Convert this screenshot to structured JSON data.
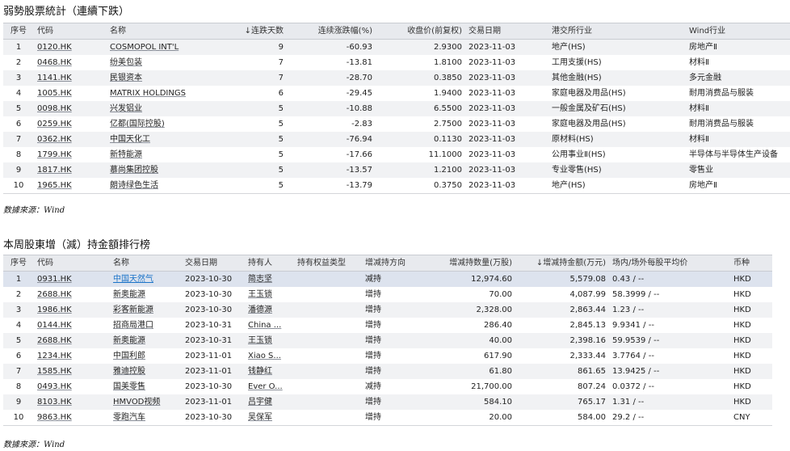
{
  "table1": {
    "title": "弱勢股票統計（連續下跌）",
    "headers": [
      "序号",
      "代码",
      "名称",
      "↓连跌天数",
      "连续涨跌幅(%)",
      "收盘价(前复权)",
      "交易日期",
      "港交所行业",
      "Wind行业"
    ],
    "rows": [
      [
        "1",
        "0120.HK",
        "COSMOPOL INT'L",
        "9",
        "-60.93",
        "2.9300",
        "2023-11-03",
        "地产(HS)",
        "房地产Ⅱ"
      ],
      [
        "2",
        "0468.HK",
        "纷美包装",
        "7",
        "-13.81",
        "1.8100",
        "2023-11-03",
        "工用支援(HS)",
        "材料Ⅱ"
      ],
      [
        "3",
        "1141.HK",
        "民银资本",
        "7",
        "-28.70",
        "0.3850",
        "2023-11-03",
        "其他金融(HS)",
        "多元金融"
      ],
      [
        "4",
        "1005.HK",
        "MATRIX HOLDINGS",
        "6",
        "-29.45",
        "1.9400",
        "2023-11-03",
        "家庭电器及用品(HS)",
        "耐用消费品与服装"
      ],
      [
        "5",
        "0098.HK",
        "兴发铝业",
        "5",
        "-10.88",
        "6.5500",
        "2023-11-03",
        "一般金属及矿石(HS)",
        "材料Ⅱ"
      ],
      [
        "6",
        "0259.HK",
        "亿都(国际控股)",
        "5",
        "-2.83",
        "2.7500",
        "2023-11-03",
        "家庭电器及用品(HS)",
        "耐用消费品与服装"
      ],
      [
        "7",
        "0362.HK",
        "中国天化工",
        "5",
        "-76.94",
        "0.1130",
        "2023-11-03",
        "原材料(HS)",
        "材料Ⅱ"
      ],
      [
        "8",
        "1799.HK",
        "新特能源",
        "5",
        "-17.66",
        "11.1000",
        "2023-11-03",
        "公用事业Ⅱ(HS)",
        "半导体与半导体生产设备"
      ],
      [
        "9",
        "1817.HK",
        "慕尚集团控股",
        "5",
        "-13.57",
        "1.2100",
        "2023-11-03",
        "专业零售(HS)",
        "零售业"
      ],
      [
        "10",
        "1965.HK",
        "朗诗绿色生活",
        "5",
        "-13.79",
        "0.3750",
        "2023-11-03",
        "地产(HS)",
        "房地产Ⅱ"
      ]
    ],
    "source": "数據來源：Wind"
  },
  "table2": {
    "title": "本周股東增（減）持金額排行榜",
    "headers": [
      "序号",
      "代码",
      "名称",
      "交易日期",
      "持有人",
      "持有权益类型",
      "增减持方向",
      "增减持数量(万股)",
      "↓增减持金额(万元)",
      "场内/场外每股平均价",
      "币种"
    ],
    "rows": [
      [
        "1",
        "0931.HK",
        "中国天然气",
        "2023-10-30",
        "简志坚",
        "",
        "减持",
        "12,974.60",
        "5,579.08",
        "0.43 / --",
        "HKD"
      ],
      [
        "2",
        "2688.HK",
        "新奥能源",
        "2023-10-30",
        "王玉锁",
        "",
        "增持",
        "70.00",
        "4,087.99",
        "58.3999 / --",
        "HKD"
      ],
      [
        "3",
        "1986.HK",
        "彩客新能源",
        "2023-10-30",
        "潘德源",
        "",
        "增持",
        "2,328.00",
        "2,863.44",
        "1.23 / --",
        "HKD"
      ],
      [
        "4",
        "0144.HK",
        "招商局港口",
        "2023-10-31",
        "China ...",
        "",
        "增持",
        "286.40",
        "2,845.13",
        "9.9341 / --",
        "HKD"
      ],
      [
        "5",
        "2688.HK",
        "新奥能源",
        "2023-10-31",
        "王玉锁",
        "",
        "增持",
        "40.00",
        "2,398.16",
        "59.9539 / --",
        "HKD"
      ],
      [
        "6",
        "1234.HK",
        "中国利郎",
        "2023-11-01",
        "Xiao S...",
        "",
        "增持",
        "617.90",
        "2,333.44",
        "3.7764 / --",
        "HKD"
      ],
      [
        "7",
        "1585.HK",
        "雅迪控股",
        "2023-11-01",
        "钱静红",
        "",
        "增持",
        "61.80",
        "861.65",
        "13.9425 / --",
        "HKD"
      ],
      [
        "8",
        "0493.HK",
        "国美零售",
        "2023-10-30",
        "Ever O...",
        "",
        "减持",
        "21,700.00",
        "807.24",
        "0.0372 / --",
        "HKD"
      ],
      [
        "9",
        "8103.HK",
        "HMVOD视频",
        "2023-11-01",
        "吕宇健",
        "",
        "增持",
        "584.10",
        "765.17",
        "1.31 / --",
        "HKD"
      ],
      [
        "10",
        "9863.HK",
        "零跑汽车",
        "2023-10-30",
        "吴保军",
        "",
        "增持",
        "20.00",
        "584.00",
        "29.2 / --",
        "CNY"
      ]
    ],
    "source": "数據來源：Wind"
  }
}
